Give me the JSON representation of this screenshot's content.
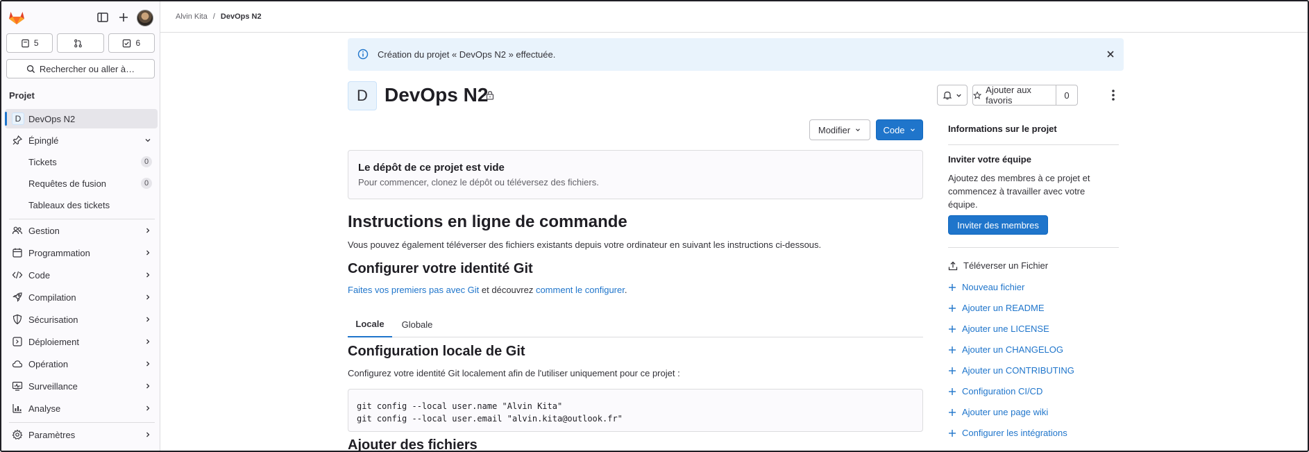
{
  "sidebar": {
    "counters": [
      {
        "icon": "issues-icon",
        "count": "5"
      },
      {
        "icon": "merge-request-icon",
        "count": ""
      },
      {
        "icon": "todo-icon",
        "count": "6"
      }
    ],
    "search_label": "Rechercher ou aller à…",
    "section_title": "Projet",
    "project_item": {
      "avatar_letter": "D",
      "label": "DevOps N2"
    },
    "pinned": {
      "label": "Épinglé",
      "items": [
        {
          "label": "Tickets",
          "badge": "0"
        },
        {
          "label": "Requêtes de fusion",
          "badge": "0"
        },
        {
          "label": "Tableaux des tickets"
        }
      ]
    },
    "nav": [
      {
        "label": "Gestion",
        "icon": "users-icon"
      },
      {
        "label": "Programmation",
        "icon": "calendar-icon"
      },
      {
        "label": "Code",
        "icon": "code-icon"
      },
      {
        "label": "Compilation",
        "icon": "rocket-icon"
      },
      {
        "label": "Sécurisation",
        "icon": "shield-icon"
      },
      {
        "label": "Déploiement",
        "icon": "deploy-icon"
      },
      {
        "label": "Opération",
        "icon": "cloud-icon"
      },
      {
        "label": "Surveillance",
        "icon": "monitor-icon"
      },
      {
        "label": "Analyse",
        "icon": "chart-icon"
      }
    ],
    "settings_label": "Paramètres"
  },
  "breadcrumb": {
    "parent": "Alvin Kita",
    "separator": "/",
    "current": "DevOps N2"
  },
  "alert": {
    "text": "Création du projet « DevOps N2 » effectuée."
  },
  "project": {
    "avatar_letter": "D",
    "title": "DevOps N2"
  },
  "header_actions": {
    "favorite_label": "Ajouter aux favoris",
    "favorite_count": "0"
  },
  "buttons": {
    "edit": "Modifier",
    "code": "Code"
  },
  "empty_repo": {
    "title": "Le dépôt de ce projet est vide",
    "subtitle": "Pour commencer, clonez le dépôt ou téléversez des fichiers."
  },
  "instructions": {
    "title": "Instructions en ligne de commande",
    "intro": "Vous pouvez également téléverser des fichiers existants depuis votre ordinateur en suivant les instructions ci-dessous.",
    "git_identity_title": "Configurer votre identité Git",
    "git_link1": "Faites vos premiers pas avec Git",
    "git_mid": " et découvrez ",
    "git_link2": "comment le configurer",
    "git_end": ".",
    "tabs": [
      "Locale",
      "Globale"
    ],
    "local_title": "Configuration locale de Git",
    "local_desc": "Configurez votre identité Git localement afin de l'utiliser uniquement pour ce projet :",
    "code_lines": [
      "git config --local user.name \"Alvin Kita\"",
      "git config --local user.email \"alvin.kita@outlook.fr\""
    ],
    "add_files_title": "Ajouter des fichiers"
  },
  "right_panel": {
    "title": "Informations sur le projet",
    "invite_heading": "Inviter votre équipe",
    "invite_text": "Ajoutez des membres à ce projet et commencez à travailler avec votre équipe.",
    "invite_button": "Inviter des membres",
    "upload_label": "Téléverser un Fichier",
    "links": [
      "Nouveau fichier",
      "Ajouter un README",
      "Ajouter une LICENSE",
      "Ajouter un CHANGELOG",
      "Ajouter un CONTRIBUTING",
      "Configuration CI/CD",
      "Ajouter une page wiki",
      "Configurer les intégrations"
    ]
  },
  "colors": {
    "accent": "#1f75cb",
    "alert_bg": "#e9f3fc",
    "sidebar_bg": "#fbfafd"
  }
}
